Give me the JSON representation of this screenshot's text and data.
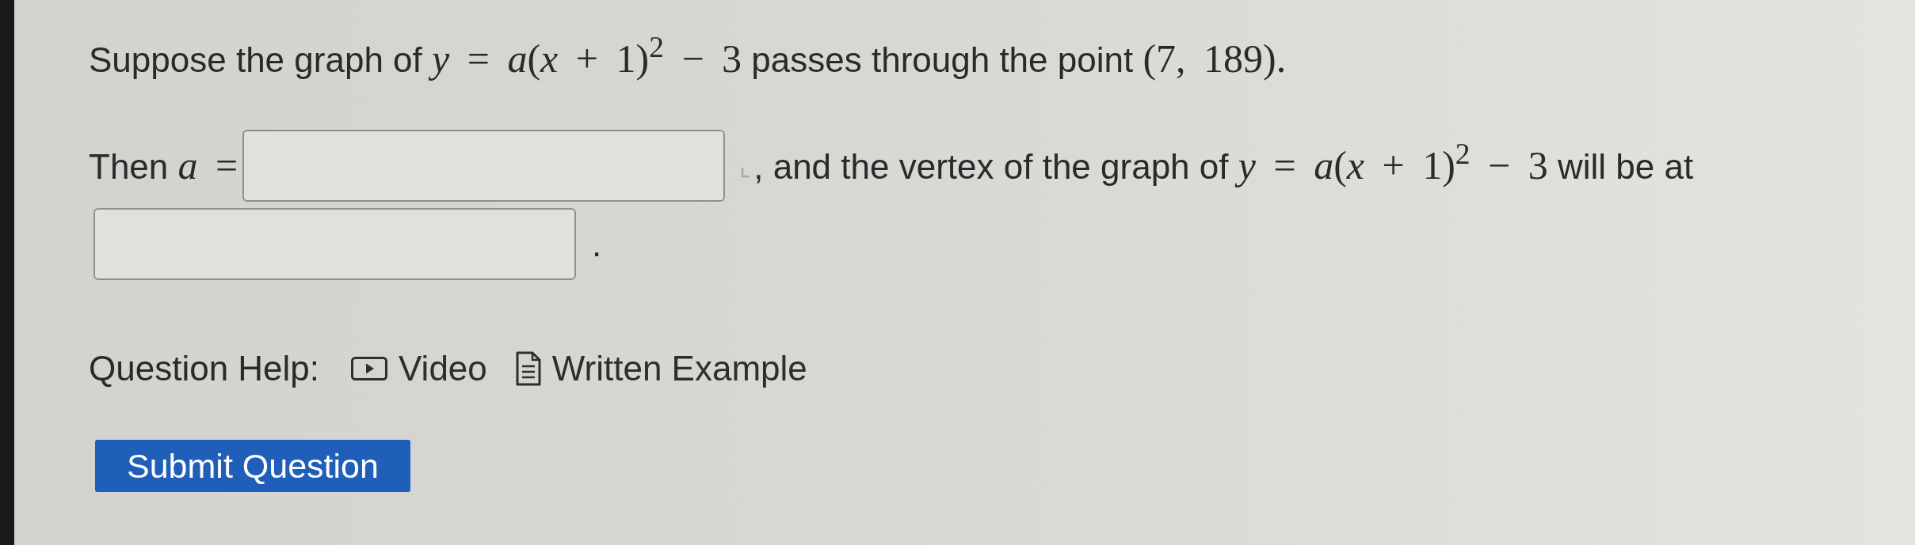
{
  "question": {
    "parts": [
      {
        "kind": "text",
        "text": "Suppose the graph of "
      },
      {
        "kind": "math",
        "text": "*y* = *a*(*x* + 1)$^{2}$ − 3"
      },
      {
        "kind": "text",
        "text": " passes through the point "
      },
      {
        "kind": "math",
        "text": "(7, 189)."
      }
    ]
  },
  "answer_line": [
    {
      "kind": "text",
      "parts": [
        {
          "kind": "text",
          "text": "Then "
        },
        {
          "kind": "math",
          "text": "*a* ="
        }
      ]
    },
    {
      "kind": "input"
    },
    {
      "kind": "marker"
    },
    {
      "kind": "text",
      "parts": [
        {
          "kind": "text",
          "text": ", and the vertex of the graph of "
        },
        {
          "kind": "math",
          "text": "*y* = *a*(*x* + 1)$^{2}$ − 3"
        },
        {
          "kind": "text",
          "text": " will be at"
        }
      ]
    },
    {
      "kind": "input"
    },
    {
      "kind": "text",
      "parts": [
        {
          "kind": "text",
          "text": "."
        }
      ]
    }
  ],
  "help": {
    "label": "Question Help:",
    "links": [
      {
        "kind": "video",
        "label": "Video"
      },
      {
        "kind": "written",
        "label": "Written Example"
      }
    ]
  },
  "submit": {
    "label": "Submit Question"
  }
}
